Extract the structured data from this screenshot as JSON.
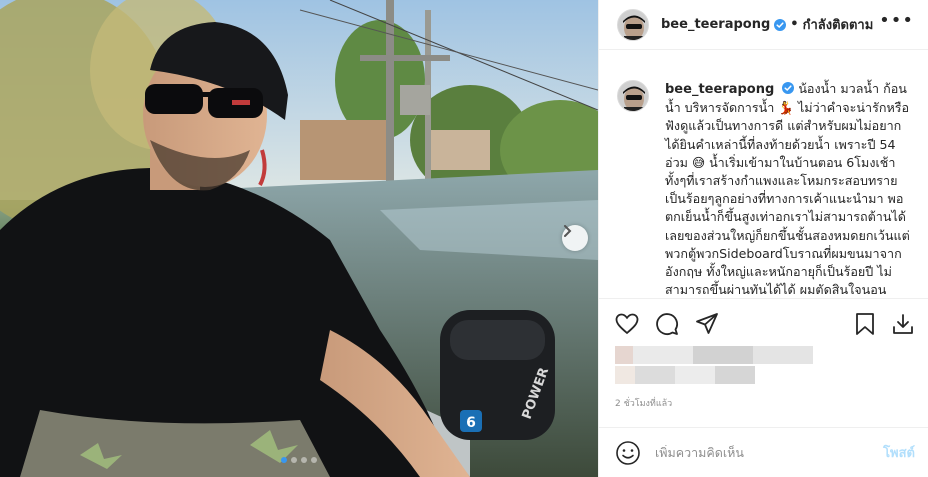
{
  "post": {
    "username": "bee_teerapong",
    "separator": "•",
    "follow_status": "กำลังติดตาม",
    "more_icon": "more-horizontal-icon",
    "caption_username": "bee_teerapong",
    "caption": "น้องน้ำ มวลน้ำ ก้อนน้ำ บริหารจัดการน้ำ 💃 ไม่ว่าคำจะน่ารักหรือฟังดูแล้วเป็นทางการดี แต่สำหรับผมไม่อยากได้ยินคำเหล่านี้ที่ลงท้ายด้วยน้ำ เพราะปี 54 อ่วม 😅 น้ำเริ่มเข้ามาในบ้านตอน 6โมงเช้า ทั้งๆที่เราสร้างกำแพงและโหมกระสอบทรายเป็นร้อยๆลูกอย่างที่ทางการเค้าแนะนำมา พอตกเย็นน้ำก็ขึ้นสูงเท่าอกเราไม่สามารถต้านได้เลยของส่วนใหญ่ก็ยกขึ้นชั้นสองหมดยกเว้นแต่พวกตู้พวกSideboardโบราณที่ผมขนมาจากอังกฤษ ทั้งใหญ่และหนักอายุก็เป็นร้อยปี ไม่สามารถขึ้นผ่านทันได้ได้ ผมตัดสินใจนอน",
    "timestamp": "2 ชั่วโมงที่แล้ว",
    "comment_placeholder": "เพิ่มความคิดเห็น",
    "post_button": "โพสต์"
  },
  "photo": {
    "motor_brand": "POWER",
    "motor_number": "6",
    "carousel_total": 4,
    "carousel_active": 1
  },
  "colors": {
    "verified_blue": "#3897f0",
    "post_button_disabled": "#b2dffc",
    "muted_text": "#8e8e8e"
  }
}
